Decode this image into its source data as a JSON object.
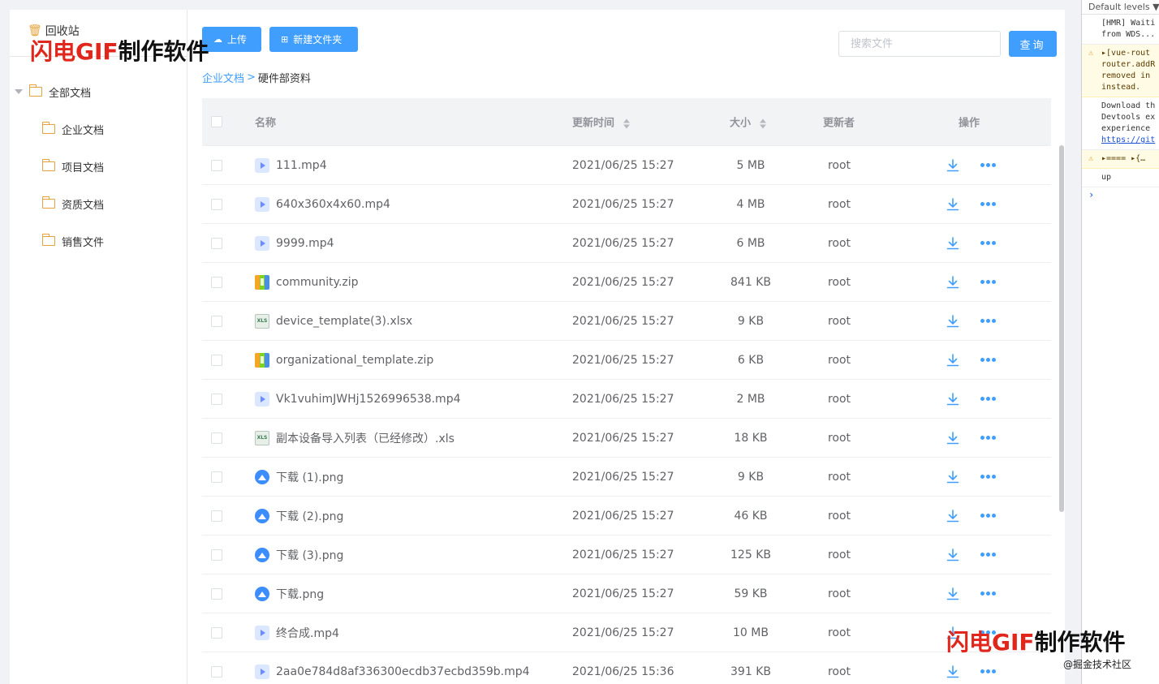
{
  "sidebar": {
    "recycle_label": "回收站",
    "tree": {
      "root_label": "全部文档",
      "children": [
        "企业文档",
        "项目文档",
        "资质文档",
        "销售文件"
      ]
    }
  },
  "toolbar": {
    "upload_label": "上传",
    "new_folder_label": "新建文件夹",
    "search_placeholder": "搜索文件",
    "search_value": "",
    "query_label": "查询"
  },
  "breadcrumb": {
    "parent": "企业文档",
    "separator": ">",
    "current": "硬件部资料"
  },
  "table": {
    "headers": {
      "name": "名称",
      "updated": "更新时间",
      "size": "大小",
      "updater": "更新者",
      "actions": "操作"
    },
    "rows": [
      {
        "name": "111.mp4",
        "icon": "video-file-icon",
        "updated": "2021/06/25 15:27",
        "size": "5 MB",
        "updater": "root"
      },
      {
        "name": "640x360x4x60.mp4",
        "icon": "video-file-icon",
        "updated": "2021/06/25 15:27",
        "size": "4 MB",
        "updater": "root"
      },
      {
        "name": "9999.mp4",
        "icon": "video-file-icon",
        "updated": "2021/06/25 15:27",
        "size": "6 MB",
        "updater": "root"
      },
      {
        "name": "community.zip",
        "icon": "zip-file-icon",
        "updated": "2021/06/25 15:27",
        "size": "841 KB",
        "updater": "root"
      },
      {
        "name": "device_template(3).xlsx",
        "icon": "excel-file-icon",
        "updated": "2021/06/25 15:27",
        "size": "9 KB",
        "updater": "root"
      },
      {
        "name": "organizational_template.zip",
        "icon": "zip-file-icon",
        "updated": "2021/06/25 15:27",
        "size": "6 KB",
        "updater": "root"
      },
      {
        "name": "Vk1vuhimJWHj1526996538.mp4",
        "icon": "video-file-icon",
        "updated": "2021/06/25 15:27",
        "size": "2 MB",
        "updater": "root"
      },
      {
        "name": "副本设备导入列表（已经修改）.xls",
        "icon": "excel-file-icon",
        "updated": "2021/06/25 15:27",
        "size": "18 KB",
        "updater": "root"
      },
      {
        "name": "下载 (1).png",
        "icon": "image-file-icon",
        "updated": "2021/06/25 15:27",
        "size": "9 KB",
        "updater": "root"
      },
      {
        "name": "下载 (2).png",
        "icon": "image-file-icon",
        "updated": "2021/06/25 15:27",
        "size": "46 KB",
        "updater": "root"
      },
      {
        "name": "下载 (3).png",
        "icon": "image-file-icon",
        "updated": "2021/06/25 15:27",
        "size": "125 KB",
        "updater": "root"
      },
      {
        "name": "下载.png",
        "icon": "image-file-icon",
        "updated": "2021/06/25 15:27",
        "size": "59 KB",
        "updater": "root"
      },
      {
        "name": "终合成.mp4",
        "icon": "video-file-icon",
        "updated": "2021/06/25 15:27",
        "size": "10 MB",
        "updater": "root"
      },
      {
        "name": "2aa0e784d8af336300ecdb37ecbd359b.mp4",
        "icon": "video-file-icon",
        "updated": "2021/06/25 15:36",
        "size": "391 KB",
        "updater": "root"
      }
    ]
  },
  "devtools": {
    "levels_label": "Default levels ▼",
    "messages": [
      {
        "type": "info",
        "lines": [
          "[HMR] Waiti",
          "from WDS..."
        ]
      },
      {
        "type": "warn",
        "lines": [
          "▸[vue-rout",
          "router.addR",
          "removed in",
          "instead."
        ]
      },
      {
        "type": "info",
        "lines": [
          "Download th",
          "Devtools ex",
          "experience"
        ],
        "link": "https://git"
      },
      {
        "type": "warn",
        "lines": [
          "▸==== ▸{…"
        ]
      },
      {
        "type": "info",
        "lines": [
          "up"
        ]
      }
    ],
    "prompt": "›"
  },
  "watermarks": {
    "brand_red": "闪电GIF",
    "brand_black": "制作软件",
    "credit": "@掘金技术社区"
  },
  "colors": {
    "primary": "#409eff",
    "folder": "#e6a23c",
    "watermark_red": "#e1261c"
  }
}
